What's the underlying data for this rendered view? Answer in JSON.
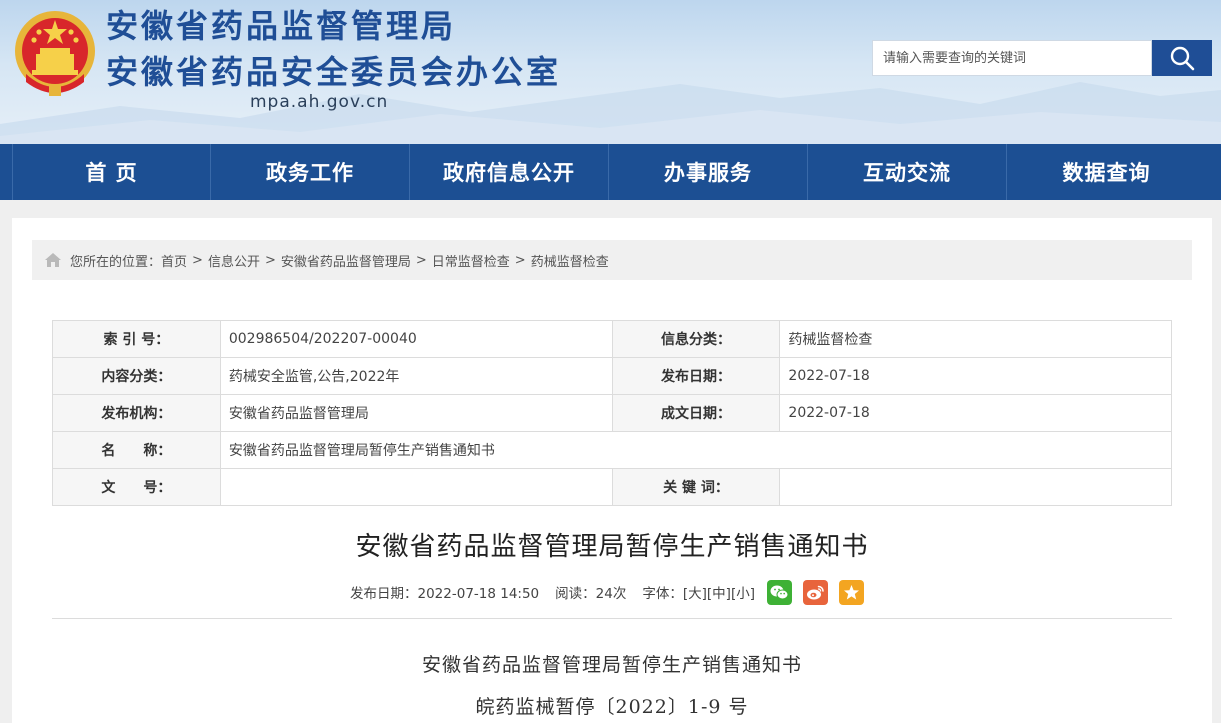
{
  "header": {
    "title_line1": "安徽省药品监督管理局",
    "title_line2": "安徽省药品安全委员会办公室",
    "domain": "mpa.ah.gov.cn",
    "search_placeholder": "请输入需要查询的关键词",
    "emblem_icon": "national-emblem-icon",
    "search_icon": "magnifier-icon"
  },
  "nav": {
    "items": [
      {
        "label": "首 页"
      },
      {
        "label": "政务工作"
      },
      {
        "label": "政府信息公开"
      },
      {
        "label": "办事服务"
      },
      {
        "label": "互动交流"
      },
      {
        "label": "数据查询"
      }
    ]
  },
  "breadcrumb": {
    "prefix": "您所在的位置：",
    "items": [
      "首页",
      "信息公开",
      "安徽省药品监督管理局",
      "日常监督检查",
      "药械监督检查"
    ],
    "separator": ">",
    "icon": "home-icon"
  },
  "meta": {
    "index_label": "索 引 号：",
    "index_value": "002986504/202207-00040",
    "category_label": "信息分类：",
    "category_value": "药械监督检查",
    "content_label": "内容分类：",
    "content_value": "药械安全监管,公告,2022年",
    "pub_date_label": "发布日期：",
    "pub_date_value": "2022-07-18",
    "org_label": "发布机构：",
    "org_value": "安徽省药品监督管理局",
    "doc_date_label": "成文日期：",
    "doc_date_value": "2022-07-18",
    "name_label": "名　　称：",
    "name_value": "安徽省药品监督管理局暂停生产销售通知书",
    "docno_label": "文　　号：",
    "docno_value": "",
    "keywords_label": "关 键 词：",
    "keywords_value": ""
  },
  "article": {
    "title": "安徽省药品监督管理局暂停生产销售通知书",
    "pub_date": "发布日期：2022-07-18 14:50",
    "reads": "阅读：24次",
    "font_label": "字体：",
    "font_large": "[大]",
    "font_medium": "[中]",
    "font_small": "[小]",
    "body_line1": "安徽省药品监督管理局暂停生产销售通知书",
    "body_line2": "皖药监械暂停〔2022〕1-9 号"
  },
  "colors": {
    "brand_blue": "#1c4f93",
    "title_blue": "#1f4e96",
    "wechat_green": "#3eb135",
    "weibo_orange": "#e8643c",
    "fav_yellow": "#f3a521"
  }
}
